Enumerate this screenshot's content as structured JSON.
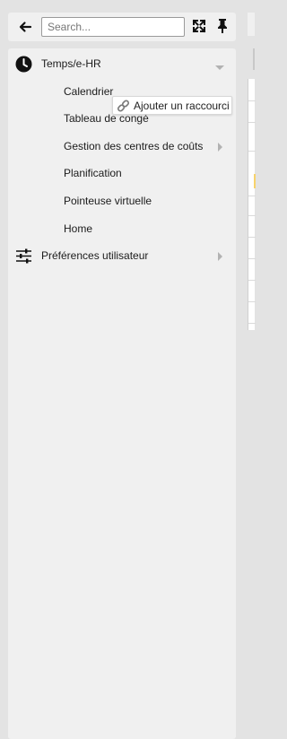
{
  "toolbar": {
    "search_placeholder": "Search..."
  },
  "menu": {
    "group1": {
      "label": "Temps/e-HR",
      "items": [
        {
          "label": "Calendrier"
        },
        {
          "label": "Tableau de congé"
        },
        {
          "label": "Gestion des centres de coûts"
        },
        {
          "label": "Planification"
        },
        {
          "label": "Pointeuse virtuelle"
        },
        {
          "label": "Home"
        }
      ]
    },
    "group2": {
      "label": "Préférences utilisateur"
    }
  },
  "tooltip": {
    "label": "Ajouter un raccourci"
  },
  "colors": {
    "panel_bg": "#f0f0f0",
    "page_bg": "#e3e3e3",
    "chevron": "#b2b2b2",
    "text": "#1b1b1b"
  }
}
